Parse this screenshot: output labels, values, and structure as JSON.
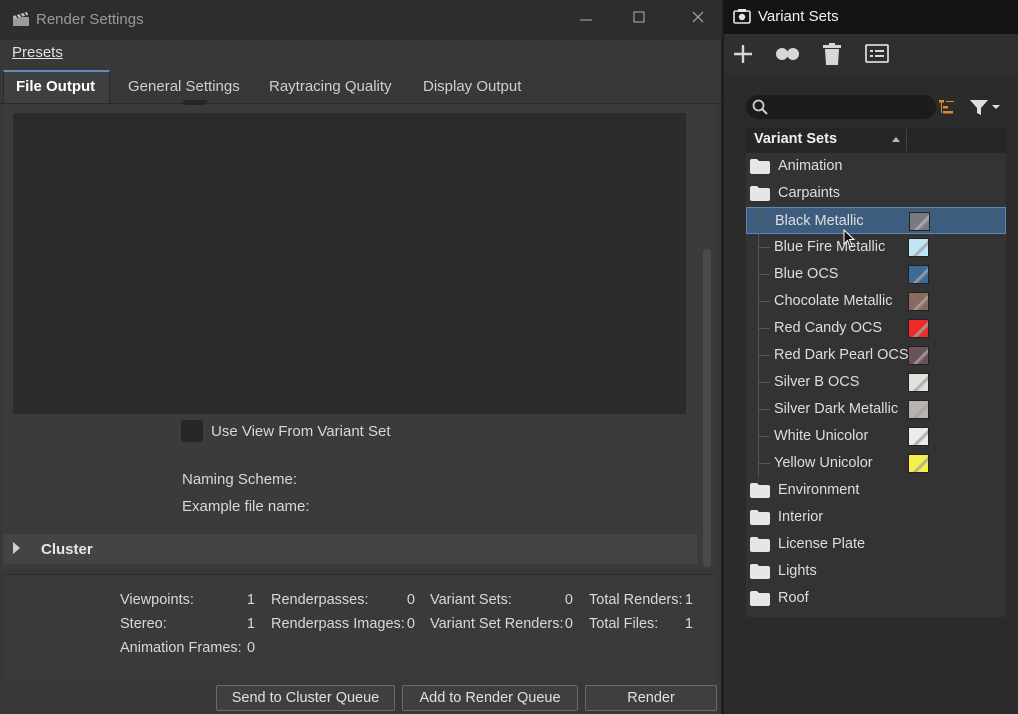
{
  "render_settings": {
    "title": "Render Settings",
    "menu": {
      "presets_label": "Presets"
    },
    "tabs": [
      {
        "label": "File Output",
        "active": true
      },
      {
        "label": "General Settings",
        "active": false
      },
      {
        "label": "Raytracing Quality",
        "active": false
      },
      {
        "label": "Display Output",
        "active": false
      }
    ],
    "use_view_label": "Use View From Variant Set",
    "naming_scheme_label": "Naming Scheme:",
    "example_file_label": "Example file name:",
    "cluster_label": "Cluster",
    "stats": {
      "viewpoints_label": "Viewpoints:",
      "viewpoints_value": "1",
      "stereo_label": "Stereo:",
      "stereo_value": "1",
      "animation_frames_label": "Animation Frames:",
      "animation_frames_value": "0",
      "renderpasses_label": "Renderpasses:",
      "renderpasses_value": "0",
      "renderpass_images_label": "Renderpass Images:",
      "renderpass_images_value": "0",
      "variant_sets_label": "Variant Sets:",
      "variant_sets_value": "0",
      "variant_set_renders_label": "Variant Set Renders:",
      "variant_set_renders_value": "0",
      "total_renders_label": "Total Renders:",
      "total_renders_value": "1",
      "total_files_label": "Total Files:",
      "total_files_value": "1"
    },
    "buttons": {
      "send_cluster": "Send to Cluster Queue",
      "add_render_queue": "Add to Render Queue",
      "render": "Render"
    }
  },
  "variant_sets": {
    "title": "Variant Sets",
    "toolbar": [
      "add-icon",
      "group-icon",
      "delete-icon",
      "settings-panel-icon"
    ],
    "search": {
      "placeholder": "",
      "value": ""
    },
    "header": "Variant Sets",
    "items": [
      {
        "label": "Animation",
        "type": "folder"
      },
      {
        "label": "Carpaints",
        "type": "folder"
      },
      {
        "label": "Black Metallic",
        "type": "variant",
        "swatch": "#7a7a7e",
        "selected": true
      },
      {
        "label": "Blue Fire Metallic",
        "type": "variant",
        "swatch": "#bfe6f5"
      },
      {
        "label": "Blue OCS",
        "type": "variant",
        "swatch": "#3f6a98"
      },
      {
        "label": "Chocolate Metallic",
        "type": "variant",
        "swatch": "#8a6a5c"
      },
      {
        "label": "Red Candy OCS",
        "type": "variant",
        "swatch": "#ee2a2a"
      },
      {
        "label": "Red Dark Pearl OCS",
        "type": "variant",
        "swatch": "#6a5258"
      },
      {
        "label": "Silver B OCS",
        "type": "variant",
        "swatch": "#e4e0dc"
      },
      {
        "label": "Silver Dark Metallic",
        "type": "variant",
        "swatch": "#b7b4b2"
      },
      {
        "label": "White Unicolor",
        "type": "variant",
        "swatch": "#ececef"
      },
      {
        "label": "Yellow Unicolor",
        "type": "variant",
        "swatch": "#f5f04a"
      },
      {
        "label": "Environment",
        "type": "folder"
      },
      {
        "label": "Interior",
        "type": "folder"
      },
      {
        "label": "License Plate",
        "type": "folder"
      },
      {
        "label": "Lights",
        "type": "folder"
      },
      {
        "label": "Roof",
        "type": "folder"
      }
    ]
  },
  "colors": {
    "accent": "#5a8dc0",
    "selection": "#3e5c7e",
    "filter_orange": "#e0892b"
  }
}
